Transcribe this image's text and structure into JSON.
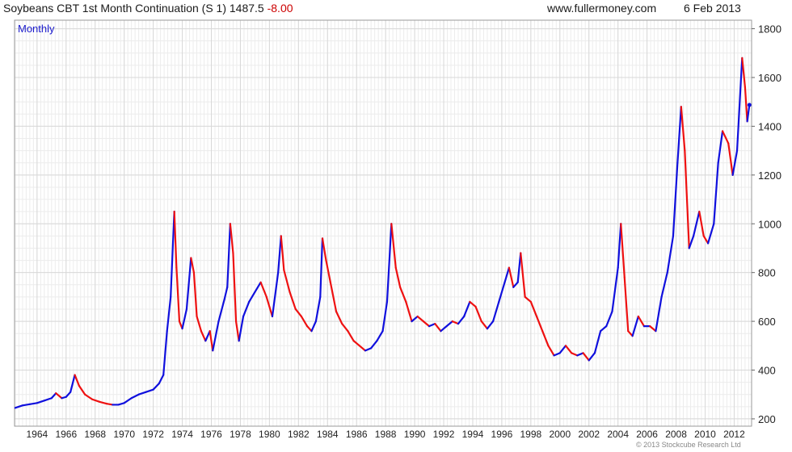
{
  "header": {
    "title": "Soybeans CBT 1st Month Continuation (S 1) 1487.5",
    "change": "-8.00",
    "site": "www.fullermoney.com",
    "date": "6 Feb 2013"
  },
  "footer": {
    "copyright": "© 2013 Stockcube Research Ltd"
  },
  "colors": {
    "up": "#1010dd",
    "down": "#ee1111",
    "grid": "#d8d8d8",
    "frame": "#9a9a9a"
  },
  "chart_data": {
    "type": "line",
    "title": "Soybeans CBT 1st Month Continuation (S 1)",
    "period_label": "Monthly",
    "y_axis_side": "right",
    "grid": true,
    "ylim": [
      170,
      1835
    ],
    "xlim": [
      1962.45,
      2013.2
    ],
    "y_ticks": [
      200,
      400,
      600,
      800,
      1000,
      1200,
      1400,
      1600,
      1800
    ],
    "x_ticks": [
      "1964",
      "1966",
      "1968",
      "1970",
      "1972",
      "1974",
      "1976",
      "1978",
      "1980",
      "1982",
      "1984",
      "1986",
      "1988",
      "1990",
      "1992",
      "1994",
      "1996",
      "1998",
      "2000",
      "2002",
      "2004",
      "2006",
      "2008",
      "2010",
      "2012"
    ],
    "series": [
      {
        "values": [
          [
            1962.5,
            245
          ],
          [
            1963.0,
            255
          ],
          [
            1963.5,
            260
          ],
          [
            1964.0,
            265
          ],
          [
            1964.5,
            275
          ],
          [
            1965.0,
            285
          ],
          [
            1965.3,
            305
          ],
          [
            1965.7,
            285
          ],
          [
            1966.0,
            290
          ],
          [
            1966.3,
            310
          ],
          [
            1966.6,
            380
          ],
          [
            1966.9,
            335
          ],
          [
            1967.3,
            300
          ],
          [
            1967.8,
            280
          ],
          [
            1968.3,
            270
          ],
          [
            1968.8,
            262
          ],
          [
            1969.2,
            258
          ],
          [
            1969.6,
            258
          ],
          [
            1970.0,
            265
          ],
          [
            1970.5,
            285
          ],
          [
            1971.0,
            300
          ],
          [
            1971.5,
            310
          ],
          [
            1972.0,
            320
          ],
          [
            1972.4,
            345
          ],
          [
            1972.7,
            380
          ],
          [
            1972.95,
            560
          ],
          [
            1973.2,
            700
          ],
          [
            1973.45,
            1050
          ],
          [
            1973.6,
            820
          ],
          [
            1973.8,
            600
          ],
          [
            1974.0,
            570
          ],
          [
            1974.3,
            650
          ],
          [
            1974.6,
            860
          ],
          [
            1974.8,
            800
          ],
          [
            1975.0,
            620
          ],
          [
            1975.3,
            560
          ],
          [
            1975.6,
            520
          ],
          [
            1975.9,
            560
          ],
          [
            1976.1,
            480
          ],
          [
            1976.5,
            600
          ],
          [
            1976.9,
            690
          ],
          [
            1977.1,
            740
          ],
          [
            1977.3,
            1000
          ],
          [
            1977.5,
            880
          ],
          [
            1977.7,
            600
          ],
          [
            1977.9,
            520
          ],
          [
            1978.2,
            620
          ],
          [
            1978.6,
            680
          ],
          [
            1979.0,
            720
          ],
          [
            1979.4,
            760
          ],
          [
            1979.8,
            700
          ],
          [
            1980.2,
            620
          ],
          [
            1980.6,
            800
          ],
          [
            1980.8,
            950
          ],
          [
            1981.0,
            810
          ],
          [
            1981.4,
            720
          ],
          [
            1981.8,
            650
          ],
          [
            1982.2,
            620
          ],
          [
            1982.6,
            580
          ],
          [
            1982.9,
            560
          ],
          [
            1983.2,
            600
          ],
          [
            1983.5,
            700
          ],
          [
            1983.65,
            940
          ],
          [
            1983.9,
            850
          ],
          [
            1984.2,
            760
          ],
          [
            1984.6,
            640
          ],
          [
            1985.0,
            590
          ],
          [
            1985.4,
            560
          ],
          [
            1985.8,
            520
          ],
          [
            1986.2,
            500
          ],
          [
            1986.6,
            480
          ],
          [
            1987.0,
            490
          ],
          [
            1987.4,
            520
          ],
          [
            1987.8,
            560
          ],
          [
            1988.1,
            680
          ],
          [
            1988.4,
            1000
          ],
          [
            1988.7,
            820
          ],
          [
            1989.0,
            740
          ],
          [
            1989.4,
            680
          ],
          [
            1989.8,
            600
          ],
          [
            1990.2,
            620
          ],
          [
            1990.6,
            600
          ],
          [
            1991.0,
            580
          ],
          [
            1991.4,
            590
          ],
          [
            1991.8,
            560
          ],
          [
            1992.2,
            580
          ],
          [
            1992.6,
            600
          ],
          [
            1993.0,
            590
          ],
          [
            1993.4,
            620
          ],
          [
            1993.8,
            680
          ],
          [
            1994.2,
            660
          ],
          [
            1994.6,
            600
          ],
          [
            1995.0,
            570
          ],
          [
            1995.4,
            600
          ],
          [
            1995.8,
            680
          ],
          [
            1996.2,
            760
          ],
          [
            1996.5,
            820
          ],
          [
            1996.8,
            740
          ],
          [
            1997.1,
            760
          ],
          [
            1997.3,
            880
          ],
          [
            1997.6,
            700
          ],
          [
            1998.0,
            680
          ],
          [
            1998.4,
            620
          ],
          [
            1998.8,
            560
          ],
          [
            1999.2,
            500
          ],
          [
            1999.6,
            460
          ],
          [
            2000.0,
            470
          ],
          [
            2000.4,
            500
          ],
          [
            2000.8,
            470
          ],
          [
            2001.2,
            460
          ],
          [
            2001.6,
            470
          ],
          [
            2002.0,
            440
          ],
          [
            2002.4,
            470
          ],
          [
            2002.8,
            560
          ],
          [
            2003.2,
            580
          ],
          [
            2003.6,
            640
          ],
          [
            2004.0,
            820
          ],
          [
            2004.2,
            1000
          ],
          [
            2004.45,
            780
          ],
          [
            2004.7,
            560
          ],
          [
            2005.0,
            540
          ],
          [
            2005.4,
            620
          ],
          [
            2005.8,
            580
          ],
          [
            2006.2,
            580
          ],
          [
            2006.6,
            560
          ],
          [
            2007.0,
            700
          ],
          [
            2007.4,
            800
          ],
          [
            2007.8,
            950
          ],
          [
            2008.1,
            1250
          ],
          [
            2008.35,
            1480
          ],
          [
            2008.6,
            1300
          ],
          [
            2008.9,
            900
          ],
          [
            2009.2,
            950
          ],
          [
            2009.6,
            1050
          ],
          [
            2009.9,
            950
          ],
          [
            2010.2,
            920
          ],
          [
            2010.6,
            1000
          ],
          [
            2010.9,
            1250
          ],
          [
            2011.2,
            1380
          ],
          [
            2011.6,
            1330
          ],
          [
            2011.9,
            1200
          ],
          [
            2012.2,
            1300
          ],
          [
            2012.55,
            1680
          ],
          [
            2012.75,
            1560
          ],
          [
            2012.9,
            1420
          ],
          [
            2013.05,
            1487.5
          ]
        ]
      }
    ]
  }
}
